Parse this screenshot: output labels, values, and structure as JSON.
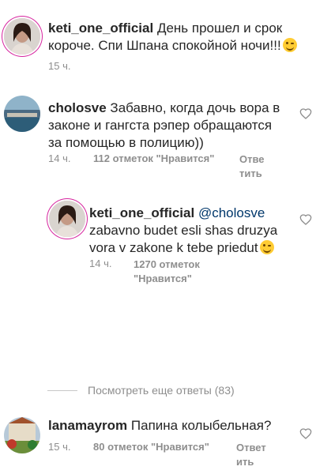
{
  "comments": [
    {
      "username": "keti_one_official",
      "text": "День прошел и срок короче. Спи Шпана спокойной ночи!!!",
      "text_line1": " День прошел и срок",
      "text_line2": "короче. Спи Шпана спокойной ночи!!!",
      "emoji": "wink-emoji",
      "time": "15 ч."
    },
    {
      "username": "cholosve",
      "text_line1": " Забавно, когда дочь вора в",
      "text_line2": "законе и гангста рэпер обращаются",
      "text_line3": "за помощью в полицию))",
      "time": "14 ч.",
      "likes": "112 отметок \"Нравится\"",
      "reply_line1": "Отве",
      "reply_line2": "тить"
    },
    {
      "username": "keti_one_official",
      "mention": " @cholosve",
      "text_line2": "zabavno budet esli shas druzya",
      "text_line3": "vora v zakone k tebe priedut",
      "emoji": "wink-emoji",
      "time": "14 ч.",
      "likes_line1": "1270 отметок",
      "likes_line2": "\"Нравится\""
    },
    {
      "username": "lanamayrom",
      "text_line1": " Папина колыбельная?",
      "time": "15 ч.",
      "likes": "80 отметок \"Нравится\"",
      "reply_line1": "Ответ",
      "reply_line2": "ить"
    }
  ],
  "view_more": "Посмотреть еще ответы (83)",
  "colors": {
    "text": "#262626",
    "meta": "#8e8e8e",
    "mention": "#00376b",
    "story_ring": "#d6249f"
  }
}
